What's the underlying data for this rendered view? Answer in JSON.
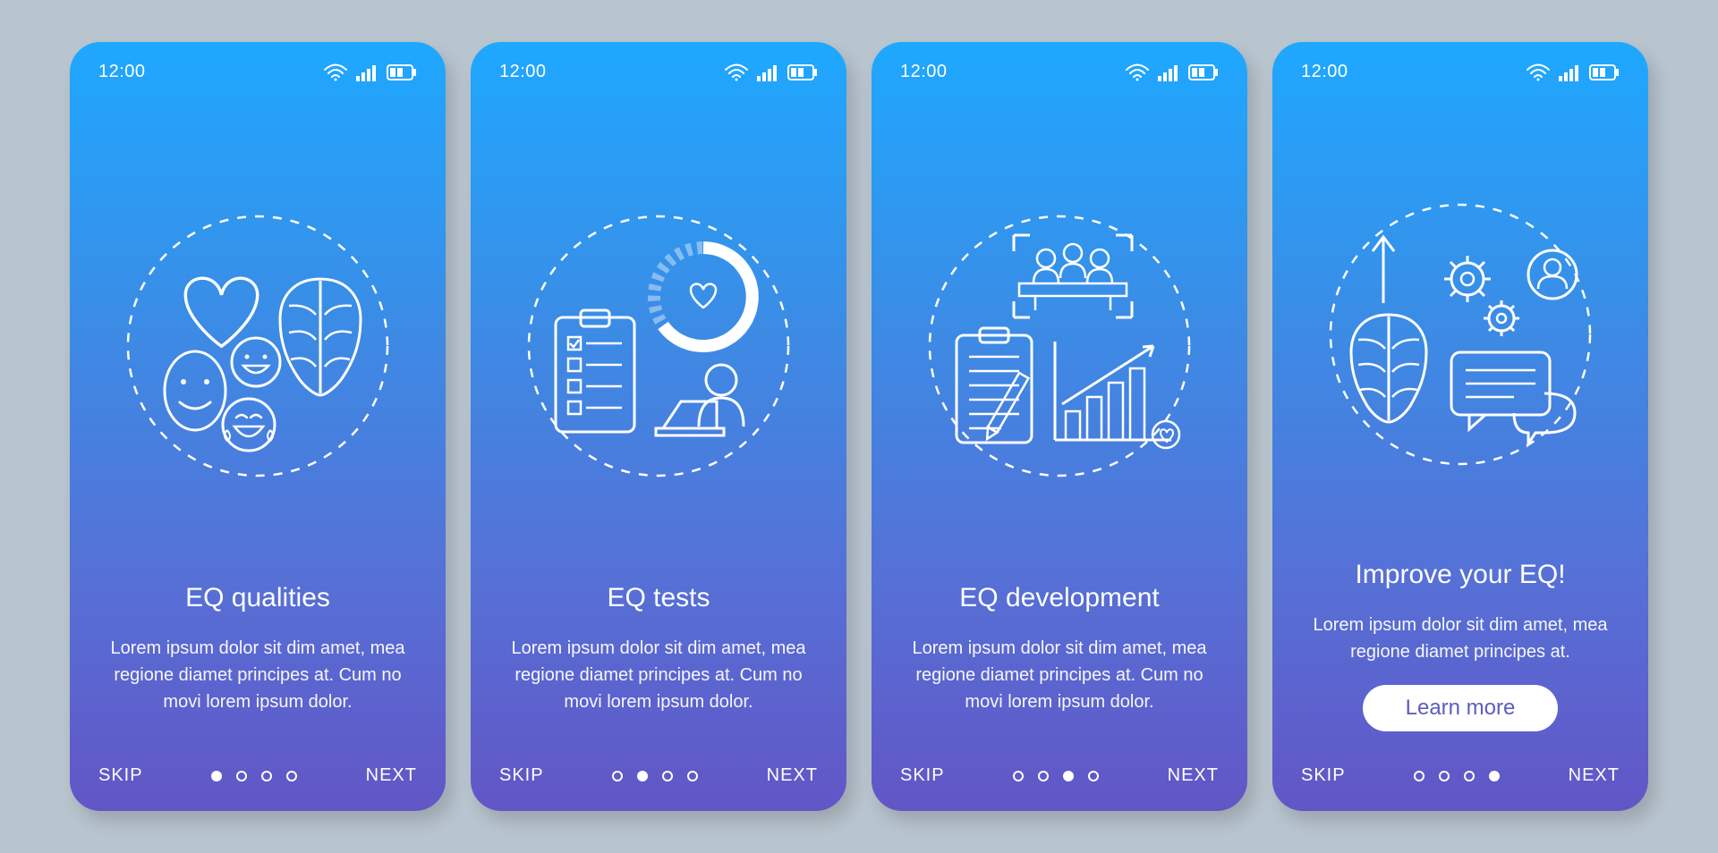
{
  "status": {
    "time": "12:00"
  },
  "footer": {
    "skip": "SKIP",
    "next": "NEXT"
  },
  "cta": {
    "label": "Learn more"
  },
  "screens": [
    {
      "title": "EQ qualities",
      "description": "Lorem ipsum dolor sit dim amet, mea regione diamet principes at. Cum no movi lorem ipsum dolor.",
      "activeDot": 0,
      "hasCta": false
    },
    {
      "title": "EQ tests",
      "description": "Lorem ipsum dolor sit dim amet, mea regione diamet principes at. Cum no movi lorem ipsum dolor.",
      "activeDot": 1,
      "hasCta": false
    },
    {
      "title": "EQ development",
      "description": "Lorem ipsum dolor sit dim amet, mea regione diamet principes at. Cum no movi lorem ipsum dolor.",
      "activeDot": 2,
      "hasCta": false
    },
    {
      "title": "Improve your EQ!",
      "description": "Lorem ipsum dolor sit dim amet, mea regione diamet principes at.",
      "activeDot": 3,
      "hasCta": true
    }
  ]
}
